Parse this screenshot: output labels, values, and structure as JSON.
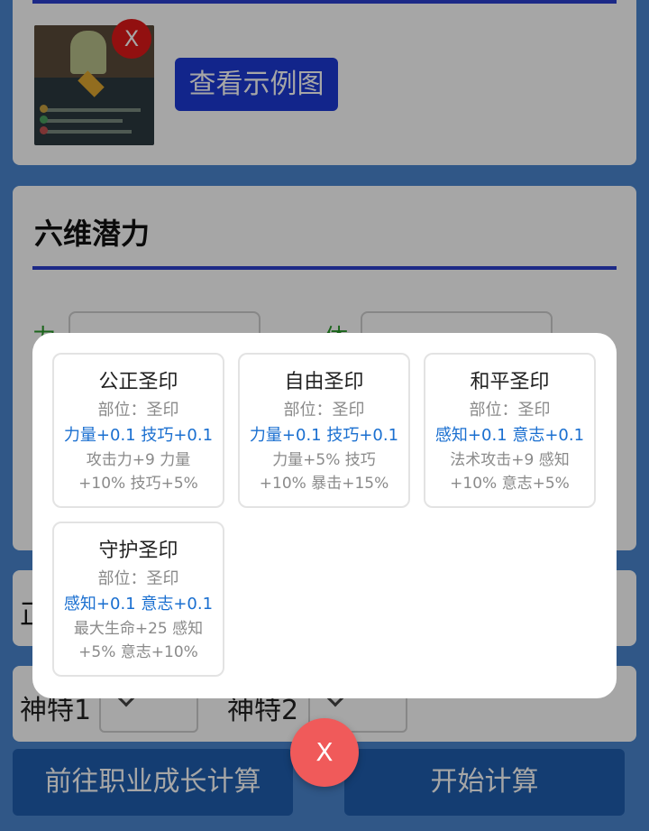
{
  "top_card": {
    "thumb_close_label": "X",
    "example_button_label": "查看示例图"
  },
  "potential": {
    "title": "六维潜力",
    "field_1_glyph": "力",
    "field_2_glyph": "体"
  },
  "mid_card": {
    "glyph": "正"
  },
  "shen_row": {
    "label_1": "神特1",
    "label_2": "神特2"
  },
  "buttons": {
    "career_label": "前往职业成长计算",
    "start_label": "开始计算"
  },
  "seals": [
    {
      "name": "公正圣印",
      "slot": "部位：圣印",
      "growth": "力量+0.1 技巧+0.1",
      "desc": "攻击力+9 力量+10% 技巧+5%"
    },
    {
      "name": "自由圣印",
      "slot": "部位：圣印",
      "growth": "力量+0.1 技巧+0.1",
      "desc": "力量+5% 技巧+10% 暴击+15%"
    },
    {
      "name": "和平圣印",
      "slot": "部位：圣印",
      "growth": "感知+0.1 意志+0.1",
      "desc": "法术攻击+9 感知+10% 意志+5%"
    },
    {
      "name": "守护圣印",
      "slot": "部位：圣印",
      "growth": "感知+0.1 意志+0.1",
      "desc": "最大生命+25 感知+5% 意志+10%"
    }
  ],
  "modal_close_label": "X",
  "colors": {
    "page_bg": "#4a86cf",
    "accent_blue": "#2b3fd0",
    "growth_text": "#1a6fd0",
    "close_red": "#f05a5a",
    "button_blue": "#1f5fb0"
  }
}
